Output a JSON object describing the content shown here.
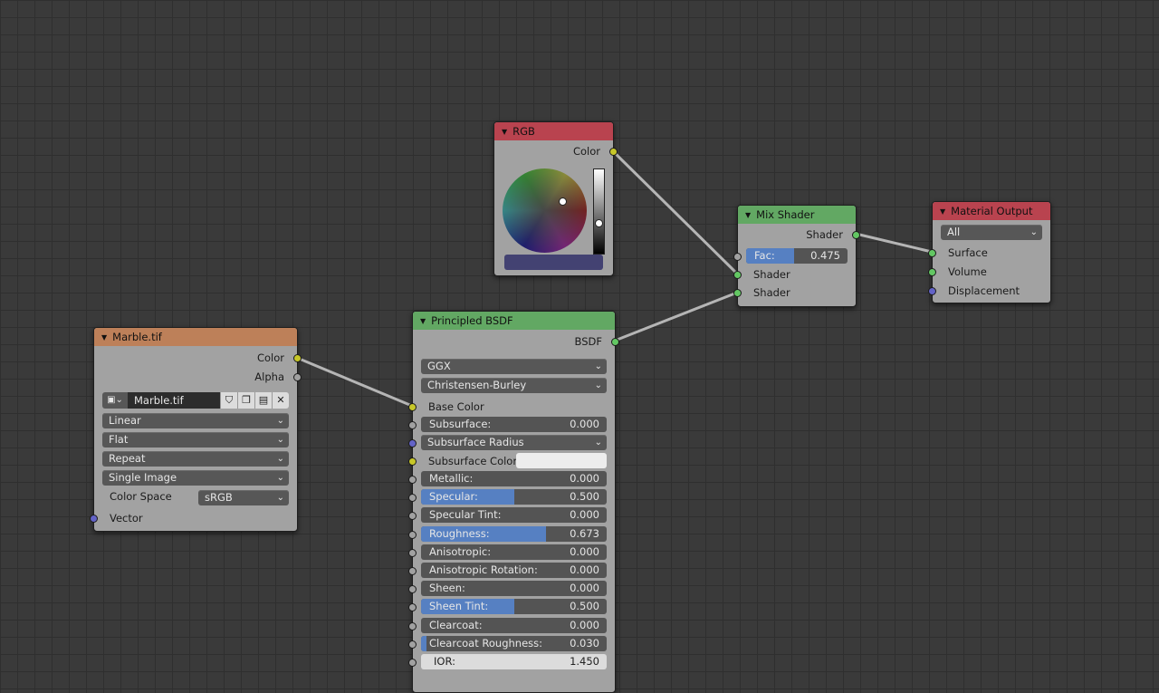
{
  "nodes": {
    "rgb": {
      "title": "RGB",
      "color_label": "Color",
      "header_color": "#b9434f",
      "picked_color": "#434272"
    },
    "mix": {
      "title": "Mix Shader",
      "header_color": "#62a863",
      "out_shader": "Shader",
      "fac_label": "Fac:",
      "fac_value": "0.475",
      "fac_fraction": 0.475,
      "in_shader_1": "Shader",
      "in_shader_2": "Shader"
    },
    "output": {
      "title": "Material Output",
      "header_color": "#b9434f",
      "target": "All",
      "surface": "Surface",
      "volume": "Volume",
      "displacement": "Displacement"
    },
    "image": {
      "title": "Marble.tif",
      "header_color": "#bd8059",
      "out_color": "Color",
      "out_alpha": "Alpha",
      "file_name": "Marble.tif",
      "interpolation": "Linear",
      "projection": "Flat",
      "extension": "Repeat",
      "source": "Single Image",
      "color_space_label": "Color Space",
      "color_space": "sRGB",
      "vector": "Vector"
    },
    "bsdf": {
      "title": "Principled BSDF",
      "header_color": "#62a863",
      "out_bsdf": "BSDF",
      "distribution": "GGX",
      "subsurface_method": "Christensen-Burley",
      "base_color": "Base Color",
      "subsurface_radius": "Subsurface Radius",
      "subsurface_color": "Subsurface Color",
      "fields": [
        {
          "label": "Subsurface:",
          "value": "0.000",
          "fraction": 0
        },
        {
          "label": "Metallic:",
          "value": "0.000",
          "fraction": 0
        },
        {
          "label": "Specular:",
          "value": "0.500",
          "fraction": 0.5
        },
        {
          "label": "Specular Tint:",
          "value": "0.000",
          "fraction": 0
        },
        {
          "label": "Roughness:",
          "value": "0.673",
          "fraction": 0.673
        },
        {
          "label": "Anisotropic:",
          "value": "0.000",
          "fraction": 0
        },
        {
          "label": "Anisotropic Rotation:",
          "value": "0.000",
          "fraction": 0
        },
        {
          "label": "Sheen:",
          "value": "0.000",
          "fraction": 0
        },
        {
          "label": "Sheen Tint:",
          "value": "0.500",
          "fraction": 0.5
        },
        {
          "label": "Clearcoat:",
          "value": "0.000",
          "fraction": 0
        },
        {
          "label": "Clearcoat Roughness:",
          "value": "0.030",
          "fraction": 0.03
        },
        {
          "label": "IOR:",
          "value": "1.450",
          "fraction": 0
        }
      ]
    }
  },
  "icons": {
    "collapse": "▼",
    "dropdown": "⌄",
    "close": "✕"
  }
}
